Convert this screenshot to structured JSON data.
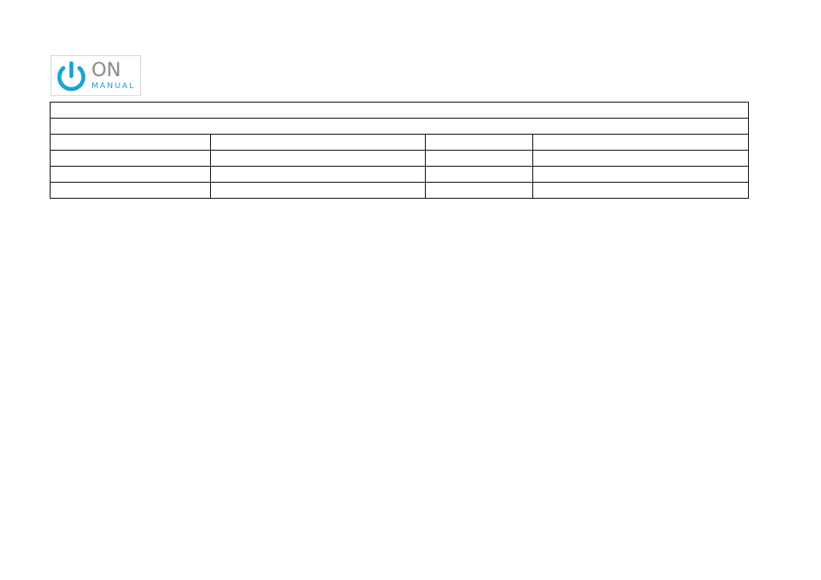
{
  "logo": {
    "word_top": "ON",
    "word_bottom": "MANUAL",
    "icon": "power-icon",
    "colors": {
      "accent": "#1aa3d9",
      "text": "#8a8a8a"
    }
  },
  "table": {
    "title_row": "",
    "subtitle_row": "",
    "rows": [
      [
        "",
        "",
        "",
        ""
      ],
      [
        "",
        "",
        "",
        ""
      ],
      [
        "",
        "",
        "",
        ""
      ],
      [
        "",
        "",
        "",
        ""
      ]
    ]
  }
}
